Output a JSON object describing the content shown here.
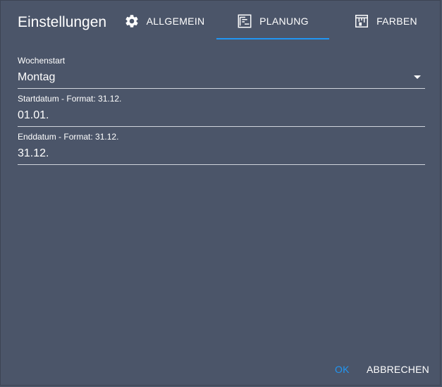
{
  "dialog": {
    "title": "Einstellungen",
    "accent_color": "#2196f3",
    "background_color": "#4b5569"
  },
  "tabs": [
    {
      "label": "ALLGEMEIN",
      "icon": "gear-icon",
      "active": false
    },
    {
      "label": "PLANUNG",
      "icon": "planning-icon",
      "active": true
    },
    {
      "label": "FARBEN",
      "icon": "paint-bucket-icon",
      "active": false
    }
  ],
  "fields": {
    "week_start": {
      "label": "Wochenstart",
      "value": "Montag"
    },
    "start_date": {
      "label": "Startdatum - Format: 31.12.",
      "value": "01.01."
    },
    "end_date": {
      "label": "Enddatum - Format: 31.12.",
      "value": "31.12."
    }
  },
  "actions": {
    "ok_label": "OK",
    "cancel_label": "ABBRECHEN"
  }
}
